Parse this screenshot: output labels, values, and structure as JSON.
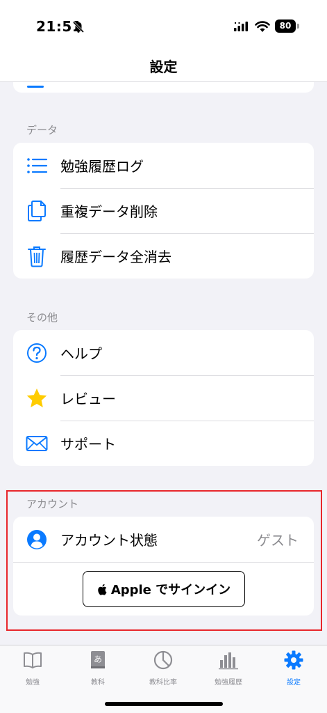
{
  "status_bar": {
    "time": "21:51",
    "battery": "80"
  },
  "nav": {
    "title": "設定"
  },
  "sections": {
    "data": {
      "header": "データ",
      "items": [
        {
          "label": "勉強履歴ログ",
          "icon": "list-icon"
        },
        {
          "label": "重複データ削除",
          "icon": "documents-icon"
        },
        {
          "label": "履歴データ全消去",
          "icon": "trash-icon"
        }
      ]
    },
    "other": {
      "header": "その他",
      "items": [
        {
          "label": "ヘルプ",
          "icon": "question-circle-icon"
        },
        {
          "label": "レビュー",
          "icon": "star-icon"
        },
        {
          "label": "サポート",
          "icon": "envelope-icon"
        }
      ]
    },
    "account": {
      "header": "アカウント",
      "status_label": "アカウント状態",
      "status_value": "ゲスト",
      "signin_label": "Apple でサインイン"
    }
  },
  "tabs": [
    {
      "label": "勉強",
      "icon": "book-icon",
      "active": false
    },
    {
      "label": "教科",
      "icon": "dictionary-icon",
      "active": false
    },
    {
      "label": "教科比率",
      "icon": "pie-chart-icon",
      "active": false
    },
    {
      "label": "勉強履歴",
      "icon": "bar-chart-icon",
      "active": false
    },
    {
      "label": "設定",
      "icon": "gear-icon",
      "active": true
    }
  ],
  "colors": {
    "accent": "#0a7aff",
    "star": "#ffcc00",
    "highlight": "#e8262b",
    "background": "#f2f2f7"
  }
}
